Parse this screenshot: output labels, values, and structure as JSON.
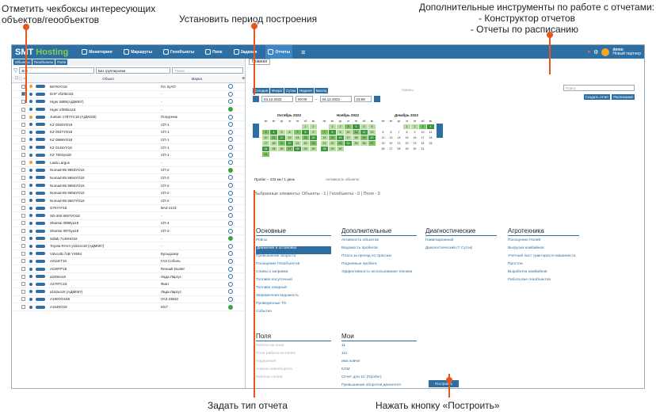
{
  "annotations": {
    "top_left": "Отметить чекбоксы интересующих объектов/геообъектов",
    "top_center": "Установить период построения",
    "top_right_title": "Дополнительные инструменты по работе с отчетами:",
    "top_right_item1": "- Конструктор отчетов",
    "top_right_item2": "- Отчеты по расписанию",
    "bottom_left": "Задать тип отчета",
    "bottom_right": "Нажать кнопку «Построить»"
  },
  "topbar": {
    "brand_a": "SMT",
    "brand_b": "Hosting",
    "nav": [
      "Мониторинг",
      "Маршруты",
      "Геообъекты",
      "Поле",
      "Задания",
      "Отчеты"
    ],
    "user": "demo",
    "user_sub": "Новый партнер"
  },
  "left": {
    "subtabs": [
      "Объекты",
      "Геообъекты",
      "Поля"
    ],
    "filter_all": "Все",
    "filter_group": "Без группировки",
    "search_placeholder": "Поиск",
    "col_object": "Объект",
    "col_mark": "Марка",
    "rows": [
      {
        "name": "В076УО18",
        "mark": "ПА ЗуАП",
        "dot": "#f0a020",
        "st": "b"
      },
      {
        "name": "DAF xf105ci18",
        "mark": "-",
        "dot": "#2d6ea3",
        "st": "b"
      },
      {
        "name": "Higer 6885(АДМ007)",
        "mark": "-",
        "dot": "#2d6ea3",
        "st": "b"
      },
      {
        "name": "Higer ef28kx118",
        "mark": "-",
        "dot": "#2d6ea3",
        "st": "g"
      },
      {
        "name": "Juntian 1787УС18 (АДМ100)",
        "mark": "Погрузчик",
        "dot": "#f0a020",
        "st": "b"
      },
      {
        "name": "KZ 0530УО18",
        "mark": "СП-1",
        "dot": "#2d6ea3",
        "st": "b"
      },
      {
        "name": "KZ 0537УО18",
        "mark": "СП-1",
        "dot": "#2d6ea3",
        "st": "b"
      },
      {
        "name": "KZ 0599УО18",
        "mark": "СП-1",
        "dot": "#2d6ea3",
        "st": "b"
      },
      {
        "name": "KZ 0145УУ18",
        "mark": "СП-1",
        "dot": "#2d6ea3",
        "st": "b"
      },
      {
        "name": "KZ 7602уа18",
        "mark": "СП-1",
        "dot": "#2d6ea3",
        "st": "b"
      },
      {
        "name": "Lada Largus",
        "mark": "-",
        "dot": "#f0a020",
        "st": "b"
      },
      {
        "name": "Nomad-85 9653УО18",
        "mark": "СП-2",
        "dot": "#2d6ea3",
        "st": "g"
      },
      {
        "name": "Nomad-85 9654УО18",
        "mark": "СП-2",
        "dot": "#2d6ea3",
        "st": "b"
      },
      {
        "name": "Nomad-85 9655УО18",
        "mark": "СП-2",
        "dot": "#2d6ea3",
        "st": "b"
      },
      {
        "name": "Nomad-85 9656УО18",
        "mark": "СП-2",
        "dot": "#2d6ea3",
        "st": "b"
      },
      {
        "name": "Nomad-85 9657УО18",
        "mark": "СП-2",
        "dot": "#2d6ea3",
        "st": "b"
      },
      {
        "name": "О757АТ18",
        "mark": "ВАЗ-2131",
        "dot": "#2d6ea3",
        "st": "b"
      },
      {
        "name": "SD-300 8007УО18",
        "mark": "-",
        "dot": "#2d6ea3",
        "st": "b"
      },
      {
        "name": "Shantui 0989уа18",
        "mark": "СП-4",
        "dot": "#2d6ea3",
        "st": "b"
      },
      {
        "name": "Shantui 0970уа18",
        "mark": "СП-3",
        "dot": "#2d6ea3",
        "st": "b"
      },
      {
        "name": "Sdlab 7148НО18",
        "mark": "-",
        "dot": "#2d6ea3",
        "st": "g"
      },
      {
        "name": "Toyota RAV4 у162ос18 (АДМ057)",
        "mark": "-",
        "dot": "#2d6ea3",
        "st": "b"
      },
      {
        "name": "Volvo BL71B Y4694",
        "mark": "Бульдозер",
        "dot": "#2d6ea3",
        "st": "b"
      },
      {
        "name": "А011ЕТ18",
        "mark": "ГАЗ Соболь",
        "dot": "#2d6ea3",
        "st": "b"
      },
      {
        "name": "А029ТР18",
        "mark": "Renault Duster",
        "dot": "#2d6ea3",
        "st": "b"
      },
      {
        "name": "а230ен18",
        "mark": "Лада Ларгус",
        "dot": "#2d6ea3",
        "st": "b"
      },
      {
        "name": "А270ТС18",
        "mark": "Фиат",
        "dot": "#2d6ea3",
        "st": "b"
      },
      {
        "name": "а152ко18 (АДМ007)",
        "mark": "Лада Ларгус",
        "dot": "#2d6ea3",
        "st": "b"
      },
      {
        "name": "А190ОО159",
        "mark": "УАЗ 23632",
        "dot": "#2d6ea3",
        "st": "b"
      },
      {
        "name": "А164КО18",
        "mark": "М17",
        "dot": "#2d6ea3",
        "st": "g"
      }
    ]
  },
  "right": {
    "tab_main": "Главная",
    "period_buttons": [
      "Сегодня",
      "Вчера",
      "Сутки",
      "Неделя",
      "Месяц"
    ],
    "smeny": "Смены",
    "date_from": "04.12.2022",
    "time_from": "00:00",
    "date_to": "04.12.2022",
    "time_to": "23:59",
    "search_placeholder": "Поиск",
    "btn_create": "Создать отчет",
    "btn_schedule": "Расписание",
    "months": [
      "Октябрь 2022",
      "Ноябрь 2022",
      "Декабрь 2022"
    ],
    "probeg": "Пробег – 233 км / 1 день",
    "activity": "Активность объекта:",
    "selected": "Выбранные элементы:  Объекты - 1  |  Геообъекты - 0  |  Поля - 0",
    "sections": {
      "osnovnye": {
        "title": "Основные",
        "items": [
          "Рейсы",
          "Движения и остановки",
          "Превышение скорости",
          "Посещение Геообъектов",
          "Сливы и заправки",
          "Топливо посуточный",
          "Топливо сводный",
          "Заправочная ведомость",
          "Проведенные ТО",
          "События"
        ]
      },
      "dopolnitelnye": {
        "title": "Дополнительные",
        "items": [
          "Активность объектов",
          "Ведомость пробегов",
          "Плата за проезд по трассам",
          "Подневные пробеги",
          "Эффективность использования техники"
        ]
      },
      "diagnosticheskie": {
        "title": "Диагностические",
        "items": [
          "Навигационный",
          "Диагностический (7 Суток)"
        ]
      },
      "agrotehnika": {
        "title": "Агротехника",
        "items": [
          "Посещение Полей",
          "Выгрузка комбайнов",
          "Учетный лист трактористе-машиниста",
          "Простои",
          "Выработка комбайнов",
          "Работа вне геообъектов"
        ]
      },
      "polya": {
        "title": "Поля",
        "items": [
          "Работы на поле",
          "Поле работы на полях",
          "Нарушения",
          "Анализ севооборота",
          "Рабочие полей"
        ]
      },
      "moi": {
        "title": "Мои",
        "items": [
          "11",
          "111",
          "имя ковчег",
          "КОМ",
          "Отчет для 1С (Пробег)",
          "Превышение оборотов двигателя",
          "Сливы/заправки"
        ]
      }
    },
    "build": "Построить"
  }
}
